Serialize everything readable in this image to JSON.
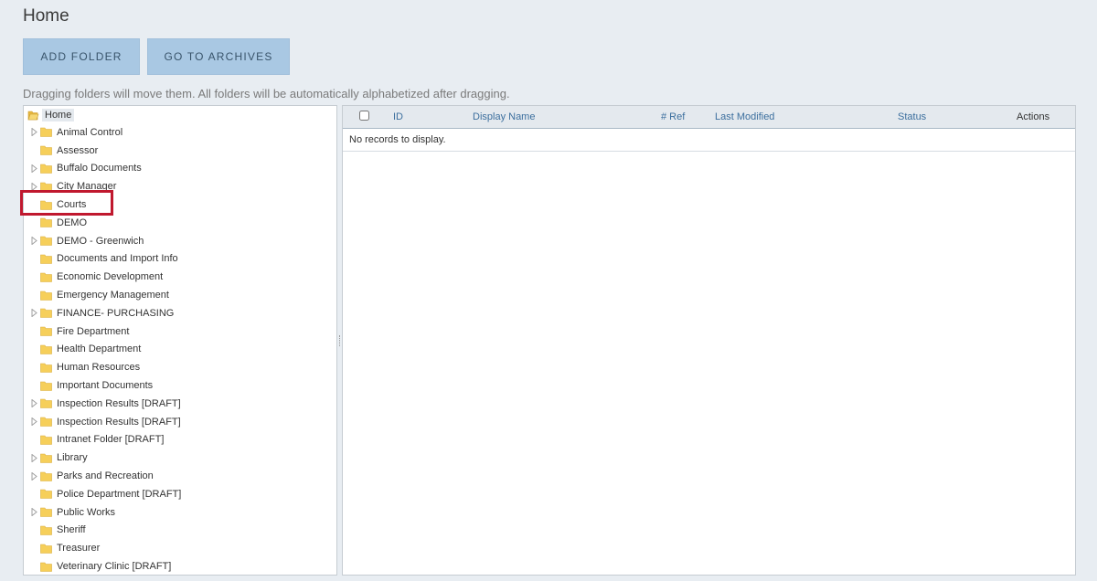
{
  "page": {
    "title": "Home",
    "hint": "Dragging folders will move them. All folders will be automatically alphabetized after dragging."
  },
  "toolbar": {
    "add_folder_label": "ADD FOLDER",
    "go_to_archives_label": "GO TO ARCHIVES"
  },
  "tree": {
    "root_label": "Home",
    "items": [
      {
        "label": "Animal Control",
        "expandable": true
      },
      {
        "label": "Assessor",
        "expandable": false
      },
      {
        "label": "Buffalo Documents",
        "expandable": true
      },
      {
        "label": "City Manager",
        "expandable": true
      },
      {
        "label": "Courts",
        "expandable": false
      },
      {
        "label": "DEMO",
        "expandable": false
      },
      {
        "label": "DEMO - Greenwich",
        "expandable": true
      },
      {
        "label": "Documents and Import Info",
        "expandable": false
      },
      {
        "label": "Economic Development",
        "expandable": false
      },
      {
        "label": "Emergency Management",
        "expandable": false
      },
      {
        "label": "FINANCE- PURCHASING",
        "expandable": true
      },
      {
        "label": "Fire Department",
        "expandable": false
      },
      {
        "label": "Health Department",
        "expandable": false
      },
      {
        "label": "Human Resources",
        "expandable": false
      },
      {
        "label": "Important Documents",
        "expandable": false
      },
      {
        "label": "Inspection Results [DRAFT]",
        "expandable": true
      },
      {
        "label": "Inspection Results [DRAFT]",
        "expandable": true
      },
      {
        "label": "Intranet Folder [DRAFT]",
        "expandable": false
      },
      {
        "label": "Library",
        "expandable": true
      },
      {
        "label": "Parks and Recreation",
        "expandable": true
      },
      {
        "label": "Police Department [DRAFT]",
        "expandable": false
      },
      {
        "label": "Public Works",
        "expandable": true
      },
      {
        "label": "Sheriff",
        "expandable": false
      },
      {
        "label": "Treasurer",
        "expandable": false
      },
      {
        "label": "Veterinary Clinic [DRAFT]",
        "expandable": false
      }
    ],
    "highlighted_item": "Courts"
  },
  "grid": {
    "columns": {
      "id": "ID",
      "display_name": "Display Name",
      "ref": "# Ref",
      "last_modified": "Last Modified",
      "status": "Status",
      "actions": "Actions"
    },
    "empty_message": "No records to display."
  },
  "colors": {
    "background": "#e8edf2",
    "button": "#a9c8e3",
    "folder": "#f6cf5a",
    "highlight": "#c0182e",
    "header_text": "#3c6f9e"
  },
  "icons": {
    "folder": "folder-icon",
    "expander": "triangle-right-icon",
    "root": "open-folder-icon"
  }
}
